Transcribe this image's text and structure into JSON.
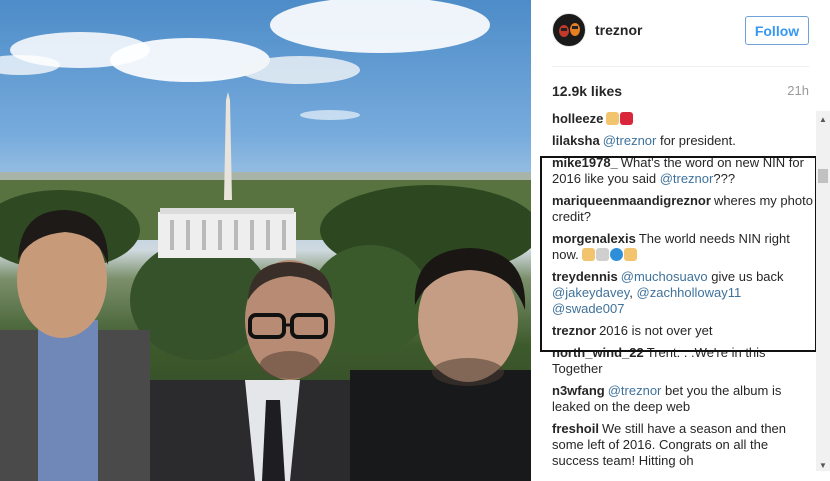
{
  "photo": {
    "description_icon": "photo-three-men-white-house"
  },
  "header": {
    "username": "treznor",
    "follow_label": "Follow",
    "avatar_icon": "profile-avatar-icon"
  },
  "meta": {
    "likes": "12.9k likes",
    "time": "21h"
  },
  "comments": [
    {
      "user": "holleeze",
      "parts": [],
      "emojis": [
        "thumbs-up-icon",
        "lips-icon"
      ]
    },
    {
      "user": "lilaksha",
      "parts": [
        {
          "t": "@treznor",
          "m": true
        },
        {
          "t": " for president.",
          "m": false
        }
      ]
    },
    {
      "user": "mike1978_",
      "parts": [
        {
          "t": "What's the word on new NIN for 2016 like you said ",
          "m": false
        },
        {
          "t": "@treznor",
          "m": true
        },
        {
          "t": "???",
          "m": false
        }
      ]
    },
    {
      "user": "mariqueenmaandigreznor",
      "parts": [
        {
          "t": "wheres my photo credit?",
          "m": false
        }
      ]
    },
    {
      "user": "morgenalexis",
      "parts": [
        {
          "t": "The world needs NIN right now. ",
          "m": false
        }
      ],
      "emojis": [
        "rock-hand-icon",
        "skull-icon",
        "globe-icon",
        "ok-hand-icon"
      ]
    },
    {
      "user": "treydennis",
      "parts": [
        {
          "t": "@muchosuavo",
          "m": true
        },
        {
          "t": " give us back ",
          "m": false
        },
        {
          "t": "@jakeydavey",
          "m": true
        },
        {
          "t": ", ",
          "m": false
        },
        {
          "t": "@zachholloway11",
          "m": true
        },
        {
          "t": " ",
          "m": false
        },
        {
          "t": "@swade007",
          "m": true
        }
      ]
    },
    {
      "user": "treznor",
      "parts": [
        {
          "t": "2016 is not over yet",
          "m": false
        }
      ]
    },
    {
      "user": "north_wind_22",
      "parts": [
        {
          "t": "Trent. . .We're in this Together",
          "m": false
        }
      ]
    },
    {
      "user": "n3wfang",
      "parts": [
        {
          "t": "@treznor",
          "m": true
        },
        {
          "t": " bet you the album is leaked on the deep web",
          "m": false
        }
      ]
    },
    {
      "user": "freshoil",
      "parts": [
        {
          "t": "We still have a season and then some left of 2016. Congrats on all the success team! Hitting oh ",
          "m": false
        }
      ]
    }
  ],
  "colors": {
    "mention": "#3f729b",
    "follow": "#3897f0",
    "highlight_border": "#111111"
  }
}
